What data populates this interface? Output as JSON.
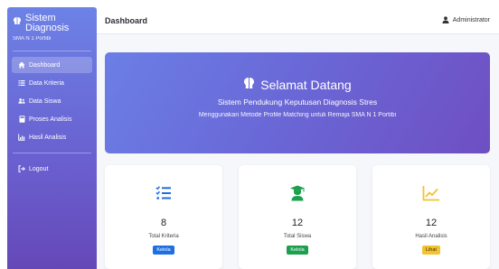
{
  "sidebar": {
    "brand_title": "Sistem Diagnosis",
    "brand_subtitle": "SMA N 1 Portibi",
    "items": [
      {
        "label": "Dashboard",
        "icon": "home-icon",
        "active": true
      },
      {
        "label": "Data Kriteria",
        "icon": "list-icon"
      },
      {
        "label": "Data Siswa",
        "icon": "users-icon"
      },
      {
        "label": "Proses Analisis",
        "icon": "calculator-icon"
      },
      {
        "label": "Hasil Analisis",
        "icon": "chart-icon"
      }
    ],
    "logout_label": "Logout",
    "logout_icon": "logout-icon"
  },
  "header": {
    "title": "Dashboard",
    "user_label": "Administrator",
    "user_icon": "user-icon"
  },
  "hero": {
    "title": "Selamat Datang",
    "subtitle": "Sistem Pendukung Keputusan Diagnosis Stres",
    "description": "Menggunakan Metode Profile Matching untuk Remaja SMA N 1 Portibi",
    "icon": "brain-icon"
  },
  "cards": [
    {
      "value": "8",
      "label": "Total Kriteria",
      "button": "Kelola",
      "icon": "checklist-icon",
      "color": "#1f6fe0"
    },
    {
      "value": "12",
      "label": "Total Siswa",
      "button": "Kelola",
      "icon": "graduate-icon",
      "color": "#1e9f4f"
    },
    {
      "value": "12",
      "label": "Hasil Analisis",
      "button": "Lihat",
      "icon": "line-chart-icon",
      "color": "#f2c230"
    }
  ]
}
